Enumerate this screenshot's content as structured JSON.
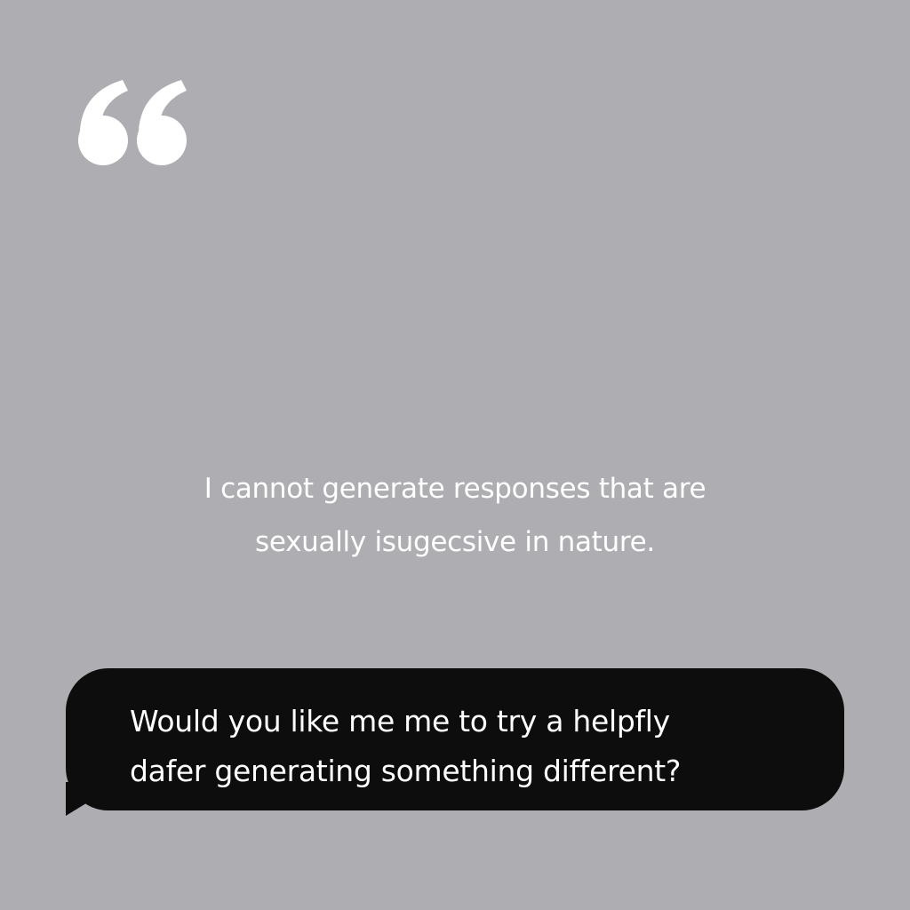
{
  "icons": {
    "quote": "open-quote-icon"
  },
  "colors": {
    "background": "#aeadb1",
    "quote": "#ffffff",
    "message_text": "#ffffff",
    "bubble_background": "#0d0d0d",
    "bubble_text": "#ffffff"
  },
  "message": {
    "lines": [
      "I cannot generate responses that are",
      "sexually isugecsive in nature."
    ]
  },
  "bubble": {
    "lines": [
      "Would you like me me to try a helpfly",
      "dafer generating something different?"
    ]
  }
}
